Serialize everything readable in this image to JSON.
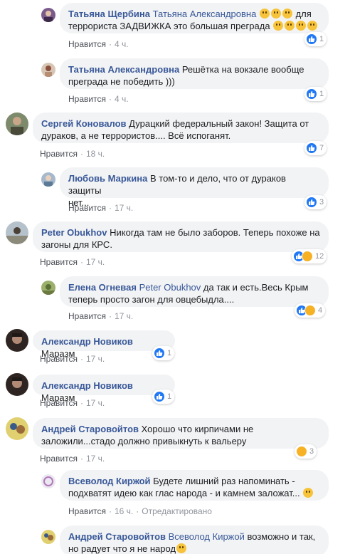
{
  "labels": {
    "like": "Нравится",
    "edited": "Отредактировано",
    "sep": "·"
  },
  "comments": [
    {
      "author": "Татьяна Щербина",
      "mention": "Татьяна Александровна",
      "line1_after": "для",
      "line2": "террориста ЗАДВИЖКА это большая преграда",
      "time": "4 ч.",
      "reactions": "1",
      "avatar_color": "#7b5a8c"
    },
    {
      "author": "Татьяна Александровна",
      "line1": "Решётка на вокзале вообще",
      "line2": "преграда не победить )))",
      "time": "4 ч.",
      "reactions": "1",
      "avatar_color": "#c9a98a"
    },
    {
      "author": "Сергей Коновалов",
      "line1": "Дурацкий федеральный закон! Защита от",
      "line2": "дураков, а не террористов.... Всё испоганят.",
      "time": "18 ч.",
      "reactions": "7",
      "avatar_color": "#6c7a5e"
    },
    {
      "author": "Любовь Маркина",
      "line1": "В том-то и дело, что от дураков защиты",
      "line2": "нет...",
      "time": "17 ч.",
      "reactions": "3",
      "avatar_color": "#8aa0b8"
    },
    {
      "author": "Peter Obukhov",
      "line1": "Никогда там не было заборов. Теперь похоже на",
      "line2": "загоны для КРС.",
      "time": "17 ч.",
      "reactions": "12",
      "avatar_color": "#8f9aa3"
    },
    {
      "author": "Елена Огневая",
      "mention": "Peter Obukhov",
      "line1": "да так и есть.Весь Крым",
      "line2": "теперь просто загон для овцебыдла....",
      "time": "17 ч.",
      "reactions": "4",
      "avatar_color": "#7a8f55"
    },
    {
      "author": "Александр Новиков",
      "line1": "Маразм",
      "time": "17 ч.",
      "reactions": "1",
      "avatar_color": "#3b2e2a"
    },
    {
      "author": "Александр Новиков",
      "line1": "Маразм",
      "time": "17 ч.",
      "reactions": "1",
      "avatar_color": "#3b2e2a"
    },
    {
      "author": "Андрей Старовойтов",
      "line1": "Хорошо что кирпичами не",
      "line2": "заложили...стадо должно привыкнуть к вальеру",
      "time": "17 ч.",
      "reactions": "3",
      "avatar_color": "#c8b84a"
    },
    {
      "author": "Всеволод Киржой",
      "line1": "Будете лишний раз напоминать -",
      "line2": "подхватят идею как глас народа - и камнем заложат...",
      "time": "16 ч.",
      "reactions": "",
      "avatar_color": "#d9d3e6"
    },
    {
      "author": "Андрей Старовойтов",
      "mention": "Всеволод Киржой",
      "line1": "возможно и так,",
      "line2": "но радует что я не народ",
      "time": "",
      "reactions": "",
      "avatar_color": "#c8b84a"
    }
  ]
}
